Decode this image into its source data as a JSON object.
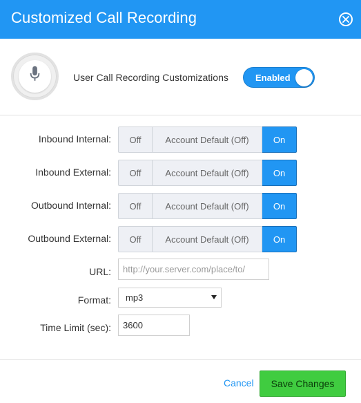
{
  "header": {
    "title": "Customized Call Recording",
    "close_icon": "close-circle-icon"
  },
  "customization": {
    "icon": "microphone-icon",
    "label": "User Call Recording Customizations",
    "toggle_label": "Enabled",
    "toggle_on": true
  },
  "recording_options": [
    {
      "label": "Inbound Internal:",
      "options": [
        "Off",
        "Account Default (Off)",
        "On"
      ],
      "selected": "On"
    },
    {
      "label": "Inbound External:",
      "options": [
        "Off",
        "Account Default (Off)",
        "On"
      ],
      "selected": "On"
    },
    {
      "label": "Outbound Internal:",
      "options": [
        "Off",
        "Account Default (Off)",
        "On"
      ],
      "selected": "On"
    },
    {
      "label": "Outbound External:",
      "options": [
        "Off",
        "Account Default (Off)",
        "On"
      ],
      "selected": "On"
    }
  ],
  "url": {
    "label": "URL:",
    "value": "",
    "placeholder": "http://your.server.com/place/to/"
  },
  "format": {
    "label": "Format:",
    "value": "mp3"
  },
  "time_limit": {
    "label": "Time Limit (sec):",
    "value": "3600"
  },
  "footer": {
    "cancel_label": "Cancel",
    "save_label": "Save Changes"
  },
  "colors": {
    "primary": "#2196f3",
    "save": "#40cc40"
  }
}
